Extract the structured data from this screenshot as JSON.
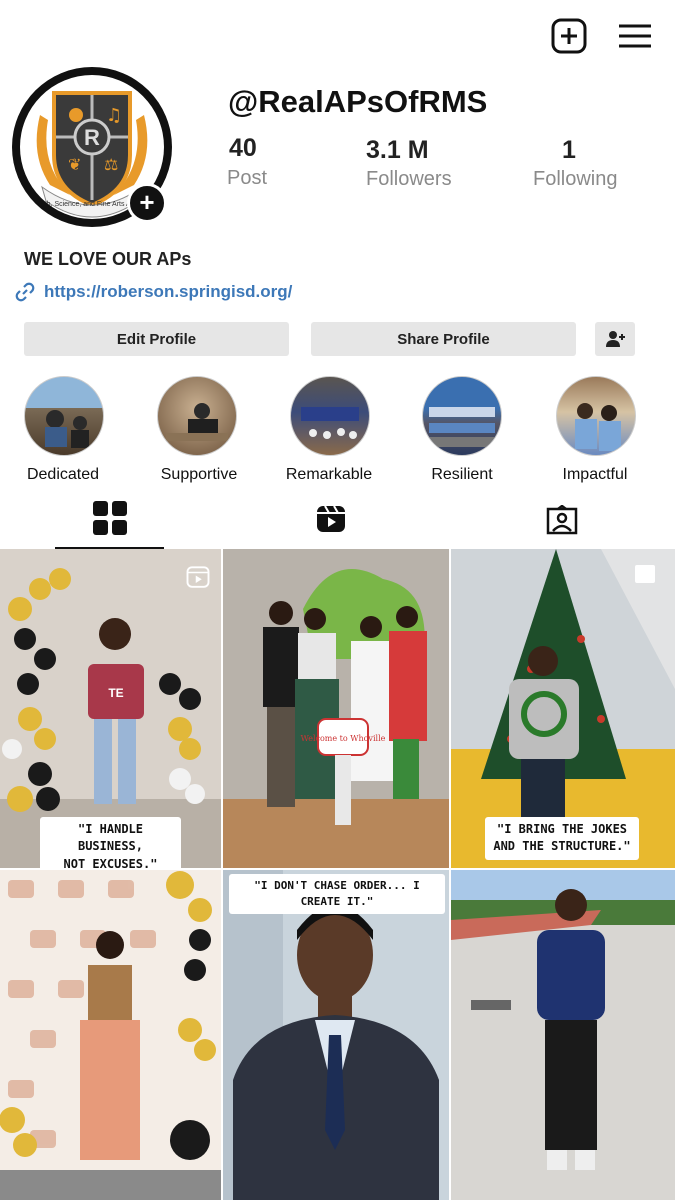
{
  "header": {
    "new_post_icon": "plus-square-icon",
    "menu_icon": "hamburger-menu-icon"
  },
  "profile": {
    "username": "@RealAPsOfRMS",
    "avatar_motto": "A Math, Science, and Fine Arts Academy",
    "avatar_letter": "R",
    "stats": [
      {
        "value": "40",
        "label": "Post"
      },
      {
        "value": "3.1 M",
        "label": "Followers"
      },
      {
        "value": "1",
        "label": "Following"
      }
    ],
    "bio": "WE LOVE OUR APs",
    "link": "https://roberson.springisd.org/"
  },
  "buttons": {
    "edit": "Edit Profile",
    "share": "Share Profile"
  },
  "highlights": [
    {
      "label": "Dedicated"
    },
    {
      "label": "Supportive"
    },
    {
      "label": "Remarkable"
    },
    {
      "label": "Resilient"
    },
    {
      "label": "Impactful"
    }
  ],
  "tabs": [
    "grid-icon",
    "reels-icon",
    "tagged-icon"
  ],
  "posts": [
    {
      "caption_line1": "\"I HANDLE BUSINESS,",
      "caption_line2": "NOT EXCUSES.\"",
      "shirt_text": "TE"
    },
    {
      "caption_line1": "",
      "caption_line2": "",
      "sign_text": "Welcome to Whoville"
    },
    {
      "caption_line1": "\"I BRING THE JOKES",
      "caption_line2": "AND THE STRUCTURE.\""
    },
    {
      "caption_line1": "",
      "caption_line2": ""
    },
    {
      "caption_line1": "\"I DON'T CHASE ORDER... I CREATE IT.\"",
      "caption_line2": ""
    },
    {
      "caption_line1": "",
      "caption_line2": ""
    }
  ],
  "colors": {
    "link": "#3d78b8",
    "button_bg": "#e6e6e6",
    "stat_label": "#8a8a8a"
  }
}
